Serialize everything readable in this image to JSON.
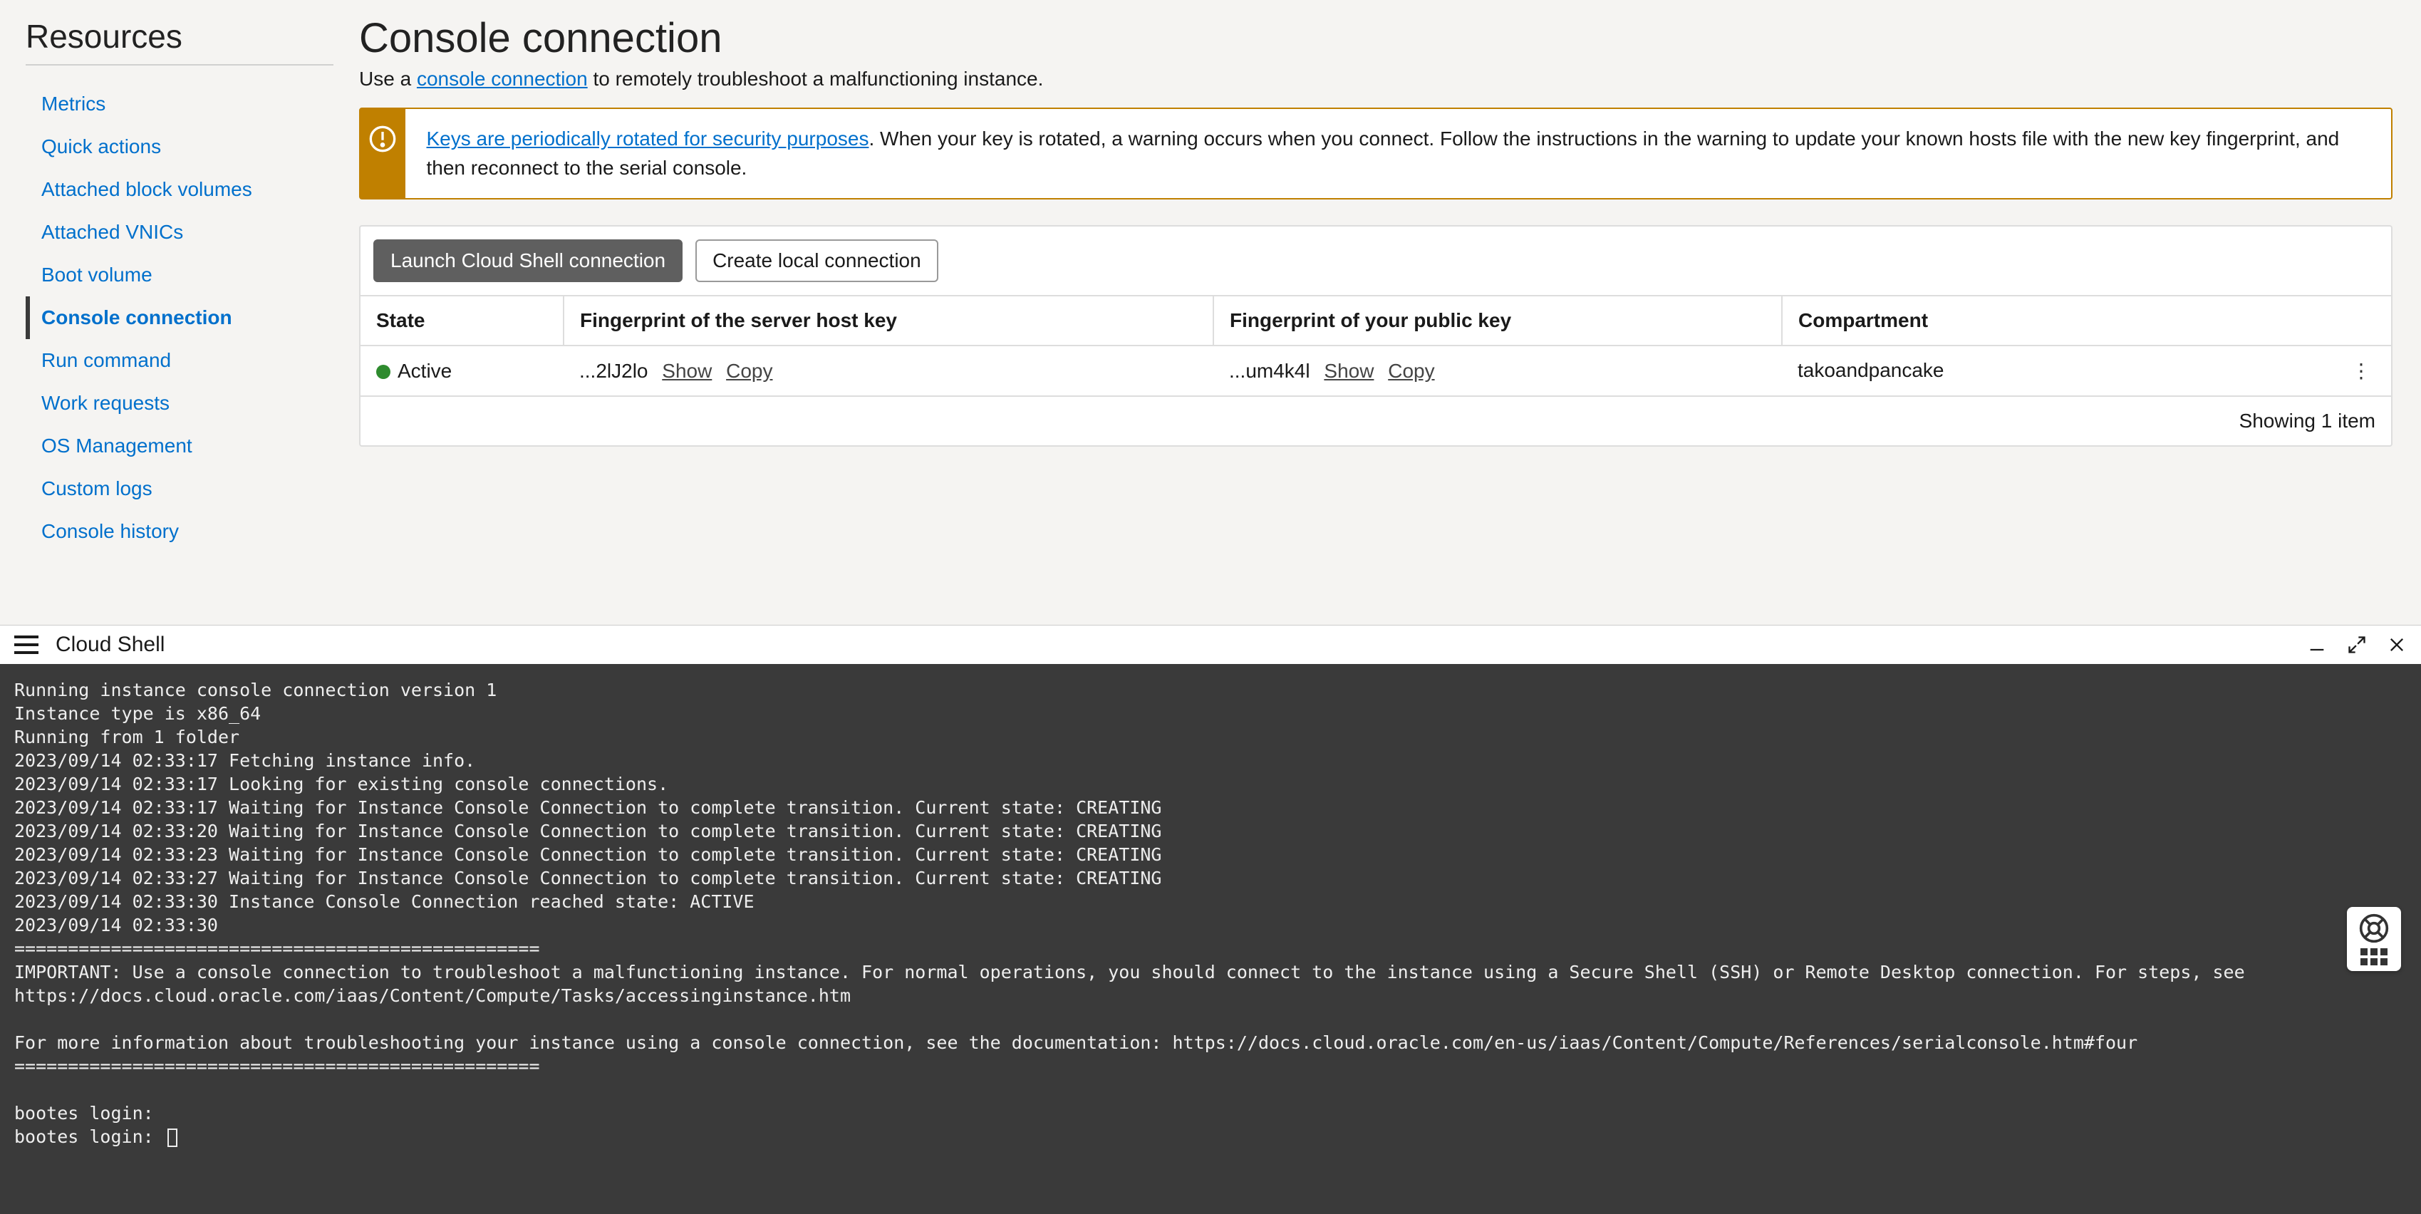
{
  "sidebar": {
    "title": "Resources",
    "items": [
      {
        "label": "Metrics"
      },
      {
        "label": "Quick actions"
      },
      {
        "label": "Attached block volumes"
      },
      {
        "label": "Attached VNICs"
      },
      {
        "label": "Boot volume"
      },
      {
        "label": "Console connection"
      },
      {
        "label": "Run command"
      },
      {
        "label": "Work requests"
      },
      {
        "label": "OS Management"
      },
      {
        "label": "Custom logs"
      },
      {
        "label": "Console history"
      }
    ],
    "active_index": 5
  },
  "main": {
    "title": "Console connection",
    "subtext_prefix": "Use a ",
    "subtext_link": "console connection",
    "subtext_suffix": " to remotely troubleshoot a malfunctioning instance.",
    "alert": {
      "link_text": "Keys are periodically rotated for security purposes",
      "rest": ". When your key is rotated, a warning occurs when you connect. Follow the instructions in the warning to update your known hosts file with the new key fingerprint, and then reconnect to the serial console."
    },
    "buttons": {
      "launch": "Launch Cloud Shell connection",
      "create": "Create local connection"
    },
    "table": {
      "headers": {
        "state": "State",
        "server_fp": "Fingerprint of the server host key",
        "public_fp": "Fingerprint of your public key",
        "compartment": "Compartment"
      },
      "row": {
        "state": "Active",
        "server_fp": "...2lJ2lo",
        "public_fp": "...um4k4l",
        "compartment": "takoandpancake"
      },
      "show_label": "Show",
      "copy_label": "Copy",
      "footer": "Showing 1 item"
    }
  },
  "shell": {
    "title": "Cloud Shell",
    "lines": "Running instance console connection version 1\nInstance type is x86_64\nRunning from 1 folder\n2023/09/14 02:33:17 Fetching instance info.\n2023/09/14 02:33:17 Looking for existing console connections.\n2023/09/14 02:33:17 Waiting for Instance Console Connection to complete transition. Current state: CREATING\n2023/09/14 02:33:20 Waiting for Instance Console Connection to complete transition. Current state: CREATING\n2023/09/14 02:33:23 Waiting for Instance Console Connection to complete transition. Current state: CREATING\n2023/09/14 02:33:27 Waiting for Instance Console Connection to complete transition. Current state: CREATING\n2023/09/14 02:33:30 Instance Console Connection reached state: ACTIVE\n2023/09/14 02:33:30\n=================================================\nIMPORTANT: Use a console connection to troubleshoot a malfunctioning instance. For normal operations, you should connect to the instance using a Secure Shell (SSH) or Remote Desktop connection. For steps, see https://docs.cloud.oracle.com/iaas/Content/Compute/Tasks/accessinginstance.htm\n\nFor more information about troubleshooting your instance using a console connection, see the documentation: https://docs.cloud.oracle.com/en-us/iaas/Content/Compute/References/serialconsole.htm#four\n=================================================\n\nbootes login:\nbootes login: "
  }
}
